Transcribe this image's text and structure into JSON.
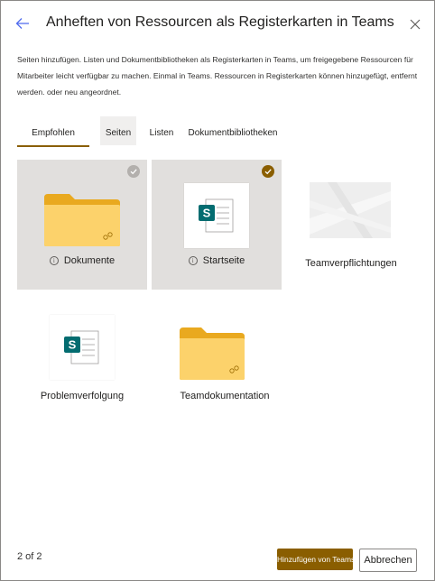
{
  "header": {
    "title": "Anheften von Ressourcen als Registerkarten in Teams"
  },
  "description": "Seiten hinzufügen. Listen und Dokumentbibliotheken als Registerkarten in Teams, um freigegebene Ressourcen für Mitarbeiter leicht verfügbar zu machen. Einmal in Teams. Ressourcen in Registerkarten können hinzugefügt, entfernt werden. oder neu angeordnet.",
  "tabs": [
    {
      "label": "Empfohlen",
      "active": true
    },
    {
      "label": "Seiten",
      "active": false
    },
    {
      "label": "Listen",
      "active": false
    },
    {
      "label": "Dokumentbibliotheken",
      "active": false
    }
  ],
  "resources": [
    {
      "label": "Dokumente",
      "kind": "folder-icon",
      "selected": true,
      "info": true
    },
    {
      "label": "Startseite",
      "kind": "sharepoint-page-icon",
      "selected": true,
      "info": true
    },
    {
      "label": "Teamverpflichtungen",
      "kind": "thumbnail",
      "selected": false,
      "info": false
    },
    {
      "label": "Problemverfolgung",
      "kind": "sharepoint-page-icon",
      "selected": false,
      "info": false
    },
    {
      "label": "Teamdokumentation",
      "kind": "folder-icon",
      "selected": false,
      "info": false
    }
  ],
  "footer": {
    "page_indicator": "2 of 2",
    "primary_label": "Hinzufügen von Teams",
    "secondary_label": "Abbrechen"
  },
  "colors": {
    "accent": "#8a5e00",
    "selected_bg": "#e1dfdd",
    "folder": "#fcd26b",
    "sharepoint": "#036c70"
  }
}
